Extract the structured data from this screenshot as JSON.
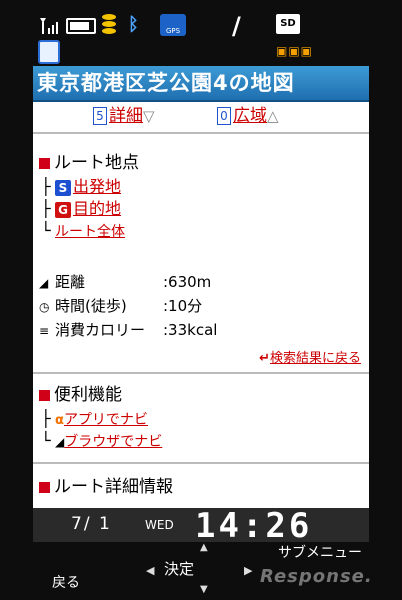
{
  "status": {
    "battery_level": 0.85,
    "gps": "GPS",
    "sd": "SD",
    "icons": [
      "antenna-icon",
      "battery-icon",
      "coin-icon",
      "bluetooth-icon",
      "gps-icon",
      "manner-mode-icon",
      "sd-card-icon"
    ]
  },
  "screen": {
    "title": "東京都港区芝公園4の地図",
    "zoom_detail_key": "5",
    "zoom_detail": "詳細",
    "zoom_wide_key": "0",
    "zoom_wide": "広域",
    "route_points": {
      "heading": "ルート地点",
      "start_badge": "S",
      "start": "出発地",
      "goal_badge": "G",
      "goal": "目的地",
      "all": "ルート全体"
    },
    "stats": {
      "distance_label": "距離",
      "distance_value": ":630m",
      "time_label": "時間(徒歩)",
      "time_value": ":10分",
      "calorie_label": "消費カロリー",
      "calorie_value": ":33kcal"
    },
    "back_link": "検索結果に戻る",
    "tools": {
      "heading": "便利機能",
      "app_nav": "アプリでナビ",
      "browser_nav": "ブラウザでナビ"
    },
    "detail_heading": "ルート詳細情報"
  },
  "clock": {
    "date": "7/ 1",
    "weekday": "WED",
    "time": "14:26"
  },
  "softkeys": {
    "left": "戻る",
    "center": "決定",
    "right": "サブメニュー"
  },
  "watermark": "Response."
}
